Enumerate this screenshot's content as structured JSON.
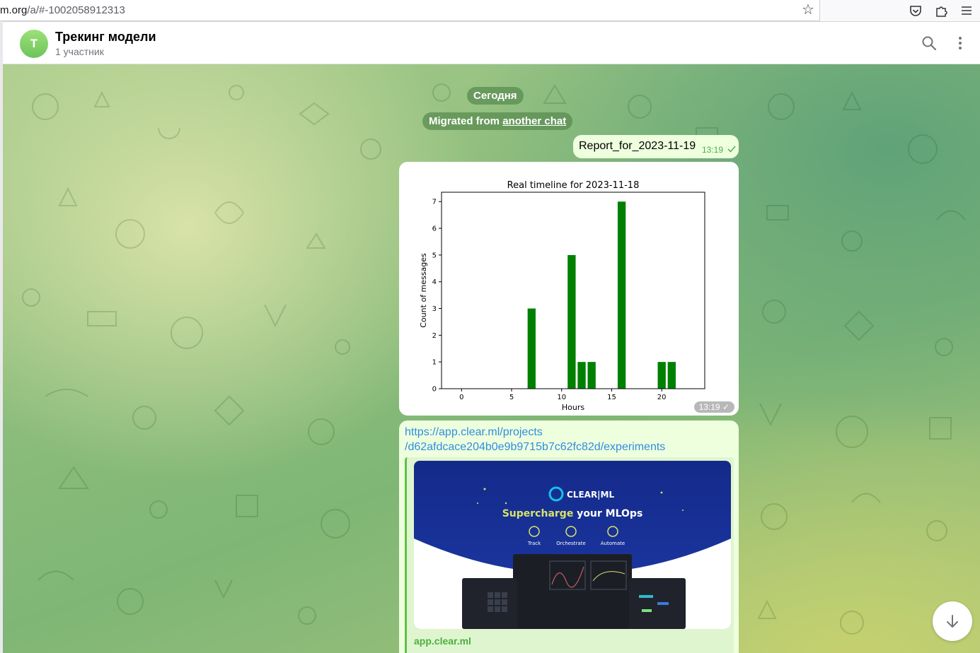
{
  "browser": {
    "url_bold": "m.org",
    "url_rest": "/a/#-1002058912313",
    "icons": [
      "star-icon",
      "pocket-icon",
      "extensions-icon",
      "menu-icon"
    ]
  },
  "header": {
    "avatar_letter": "T",
    "title": "Трекинг модели",
    "subtitle": "1 участник",
    "icons": [
      "search-icon",
      "more-vertical-icon"
    ]
  },
  "chat": {
    "date_label": "Сегодня",
    "migrated_prefix": "Migrated from ",
    "migrated_link": "another chat",
    "message1": {
      "text": "Report_for_2023-11-19",
      "time": "13:19"
    },
    "image_message": {
      "time": "13:19"
    },
    "link_message": {
      "url_line1": "https://app.clear.ml/projects",
      "url_line2": "/d62afdcace204b0e9b9715b7c62fc82d/experiments",
      "preview_logo": "CLEAR|ML",
      "preview_headline_accent": "Supercharge",
      "preview_headline_rest": " your MLOps",
      "preview_features": [
        "Track",
        "Orchestrate",
        "Automate"
      ],
      "site_name": "app.clear.ml"
    }
  },
  "colors": {
    "bubble_out": "#eeffde",
    "link": "#2f8de0",
    "bar": "#008000",
    "accent": "#4fae4e"
  },
  "chart_data": {
    "type": "bar",
    "title": "Real timeline for 2023-11-18",
    "xlabel": "Hours",
    "ylabel": "Count of messages",
    "x": [
      7,
      11,
      12,
      13,
      16,
      20,
      21
    ],
    "values": [
      3,
      5,
      1,
      1,
      7,
      1,
      1
    ],
    "xlim": [
      -2,
      24.3
    ],
    "ylim": [
      0,
      7.35
    ],
    "xticks": [
      0,
      5,
      10,
      15,
      20
    ],
    "yticks": [
      0,
      1,
      2,
      3,
      4,
      5,
      6,
      7
    ],
    "color": "#008000",
    "grid": false
  }
}
